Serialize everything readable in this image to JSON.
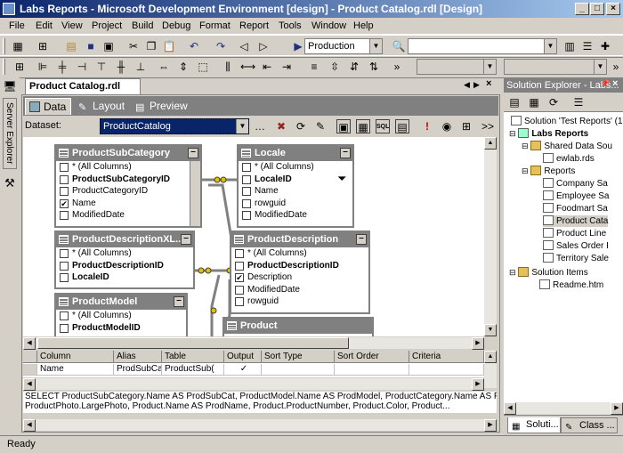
{
  "window": {
    "title": "Labs Reports - Microsoft Development Environment [design] - Product Catalog.rdl [Design]"
  },
  "menu": [
    "File",
    "Edit",
    "View",
    "Project",
    "Build",
    "Debug",
    "Format",
    "Report",
    "Tools",
    "Window",
    "Help"
  ],
  "toolbar": {
    "config_value": "Production"
  },
  "left_strip": {
    "server_explorer": "Server Explorer"
  },
  "document": {
    "tab_title": "Product Catalog.rdl [Design]",
    "tabs": {
      "data": "Data",
      "layout": "Layout",
      "preview": "Preview"
    },
    "dataset_label": "Dataset:",
    "dataset_value": "ProductCatalog"
  },
  "tables": {
    "subcategory": {
      "title": "ProductSubCategory",
      "cols": [
        "* (All Columns)",
        "ProductSubCategoryID",
        "ProductCategoryID",
        "Name",
        "ModifiedDate"
      ]
    },
    "locale": {
      "title": "Locale",
      "cols": [
        "* (All Columns)",
        "LocaleID",
        "Name",
        "rowguid",
        "ModifiedDate"
      ]
    },
    "pdxl": {
      "title": "ProductDescriptionXL...",
      "cols": [
        "* (All Columns)",
        "ProductDescriptionID",
        "LocaleID"
      ]
    },
    "pdesc": {
      "title": "ProductDescription",
      "cols": [
        "* (All Columns)",
        "ProductDescriptionID",
        "Description",
        "ModifiedDate",
        "rowguid"
      ]
    },
    "model": {
      "title": "ProductModel",
      "cols": [
        "* (All Columns)",
        "ProductModelID"
      ]
    },
    "product": {
      "title": "Product"
    }
  },
  "grid": {
    "headers": [
      "Column",
      "Alias",
      "Table",
      "Output",
      "Sort Type",
      "Sort Order",
      "Criteria"
    ],
    "row": [
      "Name",
      "ProdSubCat",
      "ProductSub(",
      "✓",
      "",
      "",
      ""
    ]
  },
  "sql": {
    "line1": "SELECT    ProductSubCategory.Name AS ProdSubCat, ProductModel.Name AS ProdModel, ProductCategory.Name AS Pr",
    "line2": "              ProductPhoto.LargePhoto, Product.Name AS ProdName, Product.ProductNumber, Product.Color, Product..."
  },
  "solution_explorer": {
    "title": "Solution Explorer - Labs...",
    "solution": "Solution 'Test Reports' (1",
    "project": "Labs Reports",
    "shared_folder": "Shared Data Sou",
    "shared_file": "ewlab.rds",
    "reports_folder": "Reports",
    "reports": [
      "Company Sa",
      "Employee Sa",
      "Foodmart Sa",
      "Product Cata",
      "Product Line",
      "Sales Order I",
      "Territory Sale"
    ],
    "items_folder": "Solution Items",
    "readme": "Readme.htm",
    "tabs": [
      "Soluti...",
      "Class ..."
    ]
  },
  "status": {
    "text": "Ready"
  }
}
